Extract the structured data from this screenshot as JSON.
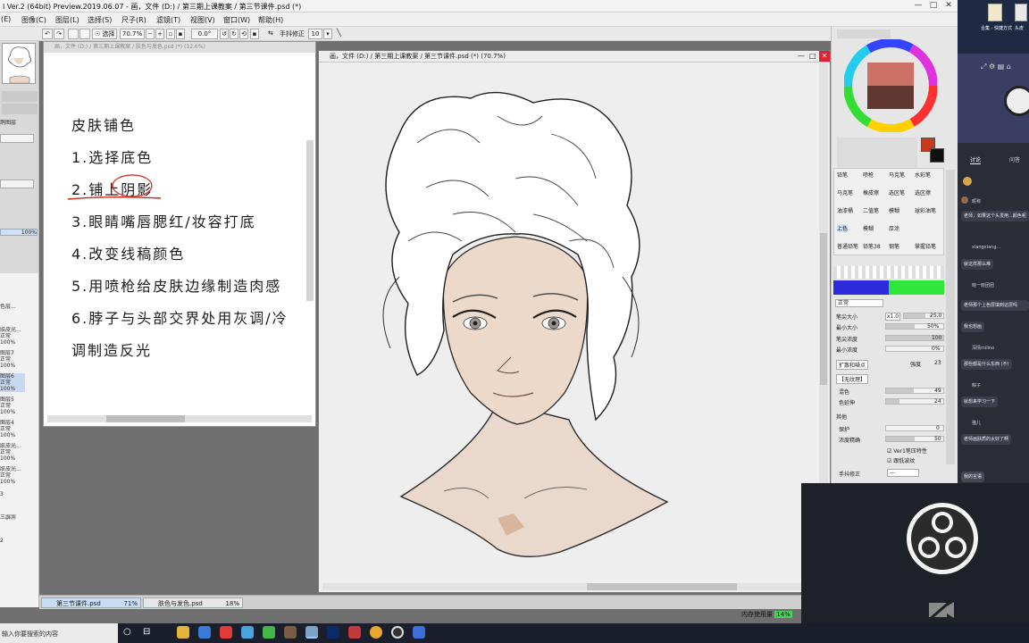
{
  "window": {
    "title": "l Ver.2 (64bit) Preview.2019.06.07 - 画，文件 (D:) / 第三期上课教案 / 第三节课件.psd (*)",
    "controls": [
      "—",
      "□",
      "✕"
    ]
  },
  "menu": [
    "(E)",
    "图像(C)",
    "图层(L)",
    "选择(S)",
    "尺子(R)",
    "滤镜(T)",
    "视图(V)",
    "窗口(W)",
    "帮助(H)"
  ],
  "toolbar": {
    "select_label": "选择",
    "zoom": "70.7%",
    "rotation": "0.0°",
    "stabilizer_label": "手抖修正",
    "stabilizer_value": "10"
  },
  "left_panel": {
    "opacity_value": "100%",
    "layer_labels": [
      "鹊图层",
      "色层...",
      "肤皮光...",
      "正常",
      "100%",
      "图层7",
      "正常",
      "100%",
      "图层6",
      "正常",
      "100%",
      "图层5",
      "正常",
      "100%",
      "图层4",
      "正常",
      "100%",
      "肤皮光...",
      "正常",
      "100%",
      "肤皮光...",
      "正常",
      "100%",
      "3",
      "三霹雳",
      "2"
    ]
  },
  "doc2": {
    "title": "画，文件 (D:) / 第三期上课教案 / 肤色与发色.psd (*) (12.6%)",
    "notes": [
      "皮肤铺色",
      "1.选择底色",
      "2.铺上阴影",
      "3.眼睛嘴唇腮红/妆容打底",
      "4.改变线稿颜色",
      "5.用喷枪给皮肤边缘制造肉感",
      "6.脖子与头部交界处用灰调/冷",
      "调制造反光"
    ]
  },
  "doc1": {
    "title": "画，文件 (D:) / 第三期上课教案 / 第三节课件.psd (*) (70.7%)"
  },
  "file_tabs": [
    {
      "name": "第三节课件.psd",
      "zoom": "71%"
    },
    {
      "name": "肤色与发色.psd",
      "zoom": "18%"
    }
  ],
  "right_panel": {
    "brush_rows": [
      [
        "铅笔",
        "喷枪",
        "马克笔",
        "水彩笔"
      ],
      [
        "马克笔",
        "橡皮擦",
        "选区笔",
        "选区擦"
      ],
      [
        "油漆桶",
        "二值笔",
        "模糊",
        "球彩油笔"
      ],
      [
        "上色",
        "模糊",
        "厚涂",
        ""
      ],
      [
        "普通铅笔",
        "铅笔38",
        "钢笔",
        "掌握铅笔"
      ]
    ],
    "blend_mode": "正常",
    "brush_size_label": "笔尖大小",
    "brush_size_mult": "x1.0",
    "brush_size_value": "25.0",
    "min_size_label": "最小大小",
    "min_size_value": "50%",
    "density_label": "笔尖浓度",
    "density_value": "100",
    "min_density_label": "最小浓度",
    "min_density_value": "0%",
    "spread_label": "扩散和噪点",
    "spread_mode": "强度",
    "spread_value": "23",
    "texture_label": "【无纹理】",
    "blend_label": "混色",
    "blend_value": "49",
    "dilute_label": "色延伸",
    "dilute_value": "24",
    "advanced_label": "其他",
    "keep_opacity_label": "保护",
    "keep_opacity_value": "0",
    "pressure_label": "浓度精确",
    "pressure_value": "50",
    "ver1_label": "Ver1笔压特性",
    "follow_label": "跟低波纹",
    "stabilizer_label": "手抖修正",
    "stabilizer_value": "---",
    "primary_color": "#c8391d",
    "secondary_color": "#101010"
  },
  "chat": {
    "tab_active": "讨论",
    "tab_other": "问答",
    "messages": [
      {
        "user": "昵称",
        "text": "老师，如果这个头发用...颜色呢"
      },
      {
        "user": "xiangxiang...",
        "text": "就这样那么难"
      },
      {
        "user": "晓一晓团团",
        "text": "xiangxiang0"
      },
      {
        "user": "",
        "text": "老师那个上色层填到这层吗"
      },
      {
        "user": "",
        "text": "我也想画"
      },
      {
        "user": "深情milino",
        "text": "那些都是什么东西 (不)"
      },
      {
        "user": "粽子",
        "text": "就想来学习一下"
      },
      {
        "user": "猫儿",
        "text": "老师画肤质的太好了啊"
      }
    ],
    "input_placeholder": "我的言语"
  },
  "status": {
    "memory_label": "内存使用量",
    "memory_value": "14%"
  },
  "taskbar": {
    "search_placeholder": "输入你要搜索的内容"
  },
  "desktop_icons": [
    {
      "label": "合集 - 快捷方式"
    },
    {
      "label": "头皮"
    }
  ]
}
